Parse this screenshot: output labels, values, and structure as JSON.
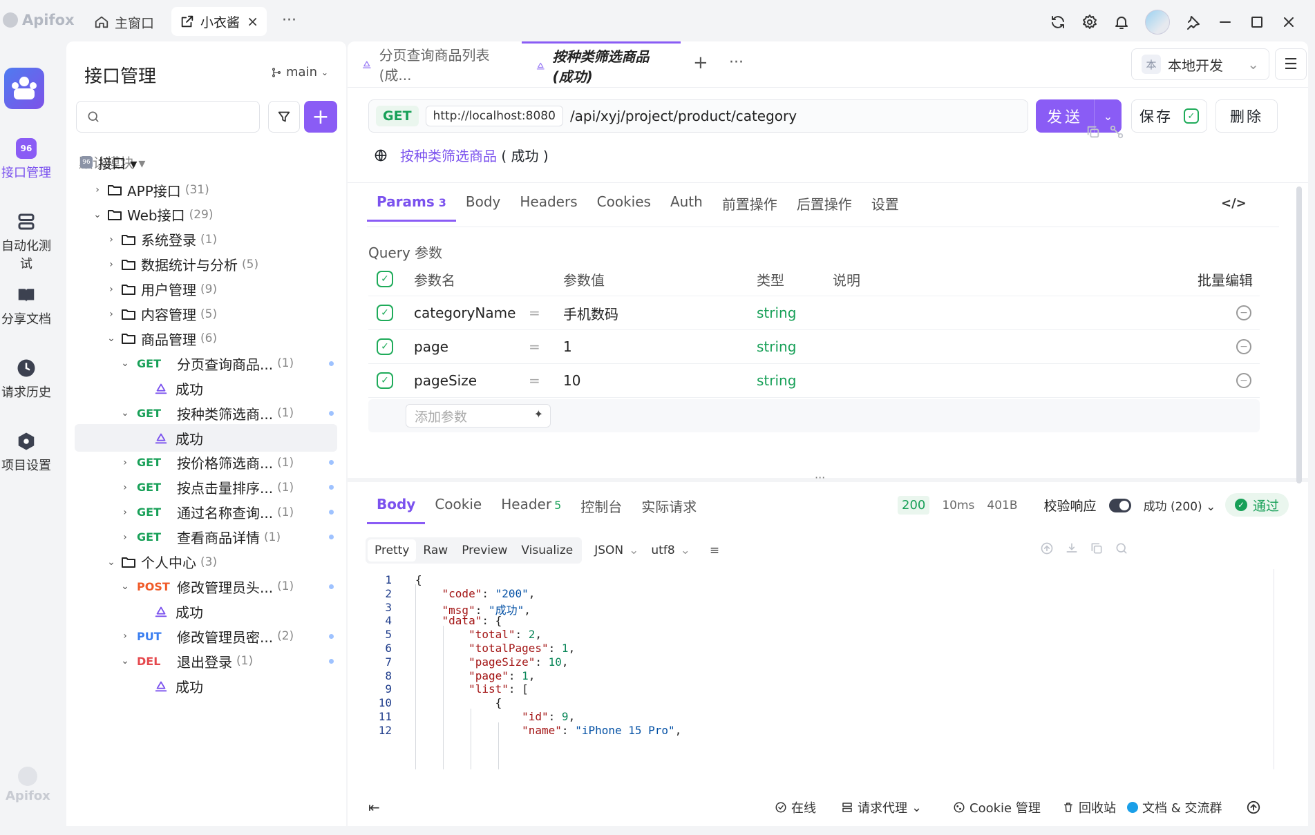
{
  "titlebar": {
    "app_name": "Apifox",
    "tab_home": "主窗口",
    "tab_project": "小衣酱",
    "tab_close": "×",
    "more": "···"
  },
  "rail": {
    "items": [
      {
        "label": "接口管理",
        "active": true
      },
      {
        "label": "自动化测试"
      },
      {
        "label": "分享文档"
      },
      {
        "label": "请求历史"
      },
      {
        "label": "项目设置"
      }
    ],
    "footer": "Apifox"
  },
  "sidebar": {
    "title": "接口管理",
    "branch": "main",
    "search_placeholder": "",
    "default_module": "默认模块 ▾",
    "root": "接口 ▾",
    "tree": [
      {
        "kind": "folder",
        "level": 1,
        "open": false,
        "label": "APP接口",
        "count": "(31)"
      },
      {
        "kind": "folder",
        "level": 1,
        "open": true,
        "label": "Web接口",
        "count": "(29)"
      },
      {
        "kind": "folder",
        "level": 2,
        "open": false,
        "label": "系统登录",
        "count": "(1)"
      },
      {
        "kind": "folder",
        "level": 2,
        "open": false,
        "label": "数据统计与分析",
        "count": "(5)"
      },
      {
        "kind": "folder",
        "level": 2,
        "open": false,
        "label": "用户管理",
        "count": "(9)"
      },
      {
        "kind": "folder",
        "level": 2,
        "open": false,
        "label": "内容管理",
        "count": "(5)"
      },
      {
        "kind": "folder",
        "level": 2,
        "open": true,
        "label": "商品管理",
        "count": "(6)"
      },
      {
        "kind": "api",
        "open": true,
        "method": "GET",
        "label": "分页查询商品...",
        "count": "(1)"
      },
      {
        "kind": "case",
        "label": "成功"
      },
      {
        "kind": "api",
        "open": true,
        "method": "GET",
        "label": "按种类筛选商...",
        "count": "(1)"
      },
      {
        "kind": "case",
        "label": "成功",
        "selected": true
      },
      {
        "kind": "api",
        "open": false,
        "method": "GET",
        "label": "按价格筛选商...",
        "count": "(1)"
      },
      {
        "kind": "api",
        "open": false,
        "method": "GET",
        "label": "按点击量排序...",
        "count": "(1)"
      },
      {
        "kind": "api",
        "open": false,
        "method": "GET",
        "label": "通过名称查询...",
        "count": "(1)"
      },
      {
        "kind": "api",
        "open": false,
        "method": "GET",
        "label": "查看商品详情",
        "count": "(1)"
      },
      {
        "kind": "folder",
        "level": 2,
        "open": true,
        "label": "个人中心",
        "count": "(3)"
      },
      {
        "kind": "api",
        "open": true,
        "method": "POST",
        "label": "修改管理员头...",
        "count": "(1)"
      },
      {
        "kind": "case",
        "label": "成功"
      },
      {
        "kind": "api",
        "open": false,
        "method": "PUT",
        "label": "修改管理员密...",
        "count": "(2)"
      },
      {
        "kind": "api",
        "open": true,
        "method": "DEL",
        "label": "退出登录",
        "count": "(1)"
      },
      {
        "kind": "case",
        "label": "成功"
      }
    ]
  },
  "main": {
    "tabs": [
      {
        "label": "分页查询商品列表 (成...",
        "active": false
      },
      {
        "label": "按种类筛选商品 (成功)",
        "active": true
      }
    ],
    "tab_add": "+",
    "tab_more": "···",
    "env_badge": "本",
    "env_name": "本地开发",
    "method": "GET",
    "host": "http://localhost:8080",
    "path": "/api/xyj/project/product/category",
    "send": "发送",
    "save": "保存",
    "delete": "删除",
    "api_name": "按种类筛选商品",
    "api_status": "( 成功 )",
    "param_tabs": [
      {
        "label": "Params",
        "count": "3",
        "active": true
      },
      {
        "label": "Body"
      },
      {
        "label": "Headers"
      },
      {
        "label": "Cookies"
      },
      {
        "label": "Auth"
      },
      {
        "label": "前置操作"
      },
      {
        "label": "后置操作"
      },
      {
        "label": "设置"
      }
    ],
    "query_label": "Query 参数",
    "cols": {
      "name": "参数名",
      "value": "参数值",
      "type": "类型",
      "desc": "说明",
      "batch": "批量编辑"
    },
    "params": [
      {
        "name": "categoryName",
        "value": "手机数码",
        "type": "string"
      },
      {
        "name": "page",
        "value": "1",
        "type": "string"
      },
      {
        "name": "pageSize",
        "value": "10",
        "type": "string"
      }
    ],
    "add_param_placeholder": "添加参数",
    "eq": "="
  },
  "response": {
    "tabs": [
      {
        "label": "Body",
        "active": true
      },
      {
        "label": "Cookie"
      },
      {
        "label": "Header",
        "count": "5"
      },
      {
        "label": "控制台"
      },
      {
        "label": "实际请求"
      }
    ],
    "status_code": "200",
    "time": "10ms",
    "size": "401B",
    "validate_label": "校验响应",
    "validate_select": "成功 (200)",
    "passed": "通过",
    "formats": [
      "Pretty",
      "Raw",
      "Preview",
      "Visualize"
    ],
    "lang": "JSON",
    "encoding": "utf8",
    "code_lines": [
      "1",
      "2",
      "3",
      "4",
      "5",
      "6",
      "7",
      "8",
      "9",
      "10",
      "11",
      "12"
    ]
  },
  "footer": {
    "online": "在线",
    "proxy": "请求代理",
    "cookie": "Cookie 管理",
    "trash": "回收站",
    "docs": "文档 & 交流群"
  },
  "colors": {
    "accent": "#8a5cf5",
    "get": "#18a058",
    "post": "#f05a28",
    "put": "#3a7ef0",
    "del": "#e5484d"
  }
}
